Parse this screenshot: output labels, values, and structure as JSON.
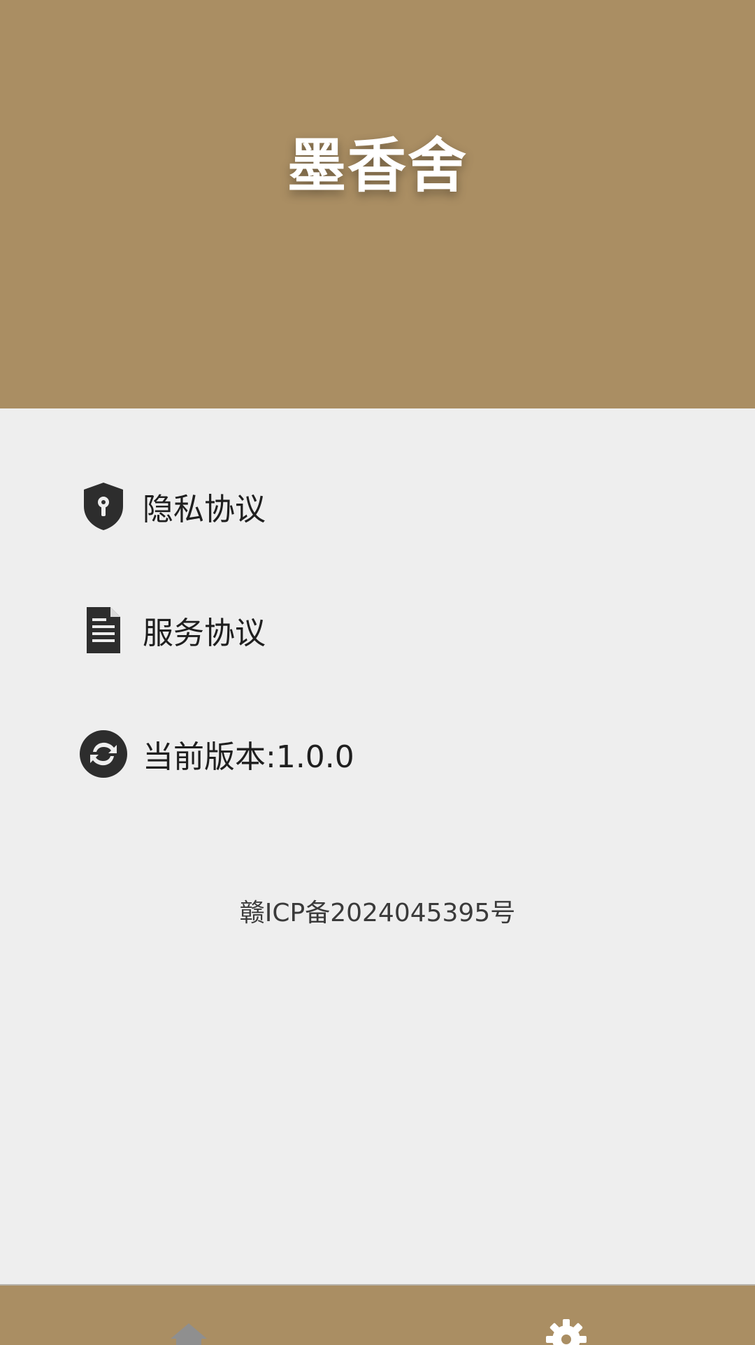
{
  "header": {
    "title": "墨香舍",
    "background": "#aa8e63"
  },
  "menu": {
    "items": [
      {
        "label": "隐私协议",
        "icon": "shield-keyhole-icon"
      },
      {
        "label": "服务协议",
        "icon": "document-icon"
      },
      {
        "label": "当前版本:1.0.0",
        "icon": "refresh-icon"
      }
    ]
  },
  "footer": {
    "icp": "赣ICP备2024045395号"
  },
  "bottom_nav": {
    "items": [
      {
        "icon": "home-icon",
        "active": false
      },
      {
        "icon": "settings-gear-icon",
        "active": true
      }
    ],
    "background": "#aa8e63"
  }
}
